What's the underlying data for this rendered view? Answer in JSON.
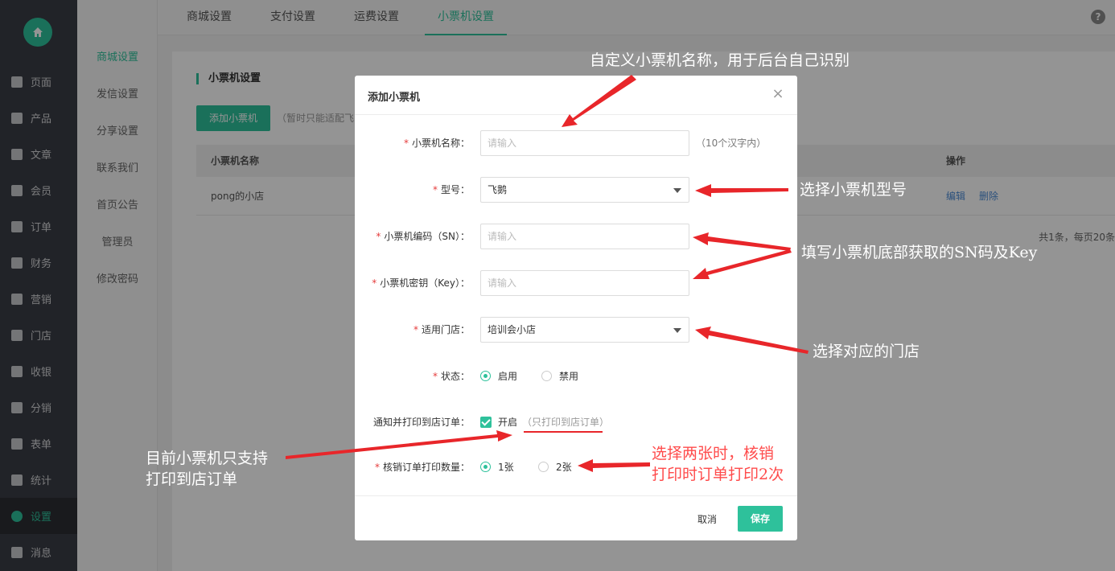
{
  "sidebar": {
    "items": [
      {
        "label": "页面",
        "icon": "tools-icon"
      },
      {
        "label": "产品",
        "icon": "grid-icon"
      },
      {
        "label": "文章",
        "icon": "document-icon"
      },
      {
        "label": "会员",
        "icon": "user-icon"
      },
      {
        "label": "订单",
        "icon": "list-icon"
      },
      {
        "label": "财务",
        "icon": "yen-icon"
      },
      {
        "label": "营销",
        "icon": "gift-icon"
      },
      {
        "label": "门店",
        "icon": "store-icon"
      },
      {
        "label": "收银",
        "icon": "download-icon"
      },
      {
        "label": "分销",
        "icon": "network-icon"
      },
      {
        "label": "表单",
        "icon": "form-icon"
      },
      {
        "label": "统计",
        "icon": "chart-icon"
      },
      {
        "label": "设置",
        "icon": "gear-icon"
      },
      {
        "label": "消息",
        "icon": "message-icon"
      }
    ],
    "active_index": 12
  },
  "submenu": {
    "items": [
      "商城设置",
      "发信设置",
      "分享设置",
      "联系我们",
      "首页公告",
      "管理员",
      "修改密码"
    ]
  },
  "tabs": [
    "商城设置",
    "支付设置",
    "运费设置",
    "小票机设置"
  ],
  "help_label": "?",
  "panel": {
    "title": "小票机设置",
    "add_button": "添加小票机",
    "add_note": "（暂时只能适配飞",
    "columns": {
      "name": "小票机名称",
      "actions": "操作"
    },
    "rows": [
      {
        "name": "pong的小店",
        "edit": "编辑",
        "delete": "删除"
      }
    ],
    "pager": "共1条，每页20条"
  },
  "modal": {
    "title": "添加小票机",
    "close_icon": "×",
    "fields": {
      "name_label": "小票机名称：",
      "name_placeholder": "请输入",
      "name_hint": "（10个汉字内）",
      "model_label": "型号：",
      "model_value": "飞鹅",
      "sn_label": "小票机编码（SN）：",
      "sn_placeholder": "请输入",
      "key_label": "小票机密钥（Key）：",
      "key_placeholder": "请输入",
      "store_label": "适用门店：",
      "store_value": "培训会小店",
      "status_label": "状态：",
      "status_on": "启用",
      "status_off": "禁用",
      "notify_label": "通知并打印到店订单：",
      "notify_check": "开启",
      "notify_sub": "（只打印到店订单）",
      "copies_label": "核销订单打印数量：",
      "copies_one": "1张",
      "copies_two": "2张"
    },
    "cancel": "取消",
    "save": "保存"
  },
  "annotations": {
    "name": "自定义小票机名称，用于后台自己识别",
    "model": "选择小票机型号",
    "sn_key": "填写小票机底部获取的SN码及Key",
    "store": "选择对应的门店",
    "notify_line1": "目前小票机只支持",
    "notify_line2": "打印到店订单",
    "copies_line1": "选择两张时，核销",
    "copies_line2": "打印时订单打印2次"
  },
  "colors": {
    "accent": "#2ec19b",
    "sidebar": "#3a3d45",
    "annotation_red": "#ff4b4b",
    "arrow": "#e8262a"
  }
}
